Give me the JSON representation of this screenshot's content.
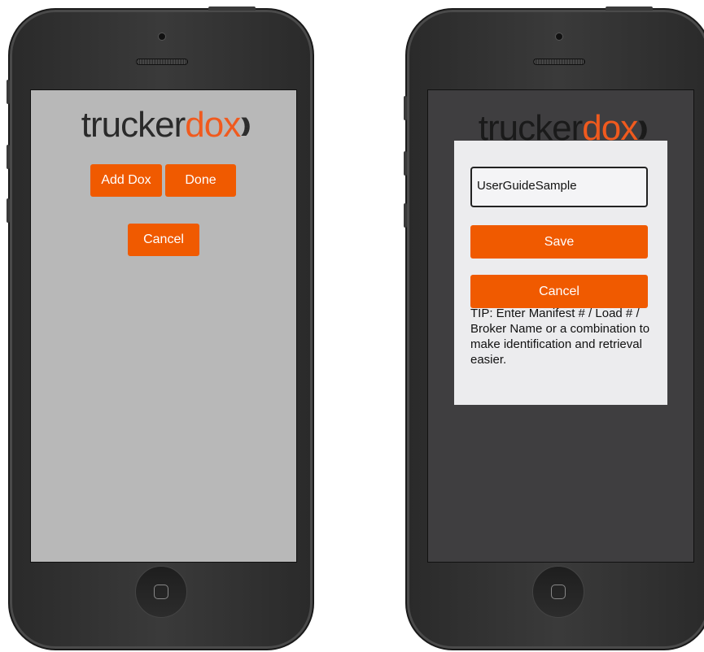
{
  "left_screen": {
    "logo": {
      "text_main": "trucker",
      "text_accent": "dox"
    },
    "buttons": {
      "add_dox": "Add Dox",
      "done": "Done",
      "cancel": "Cancel"
    }
  },
  "right_screen": {
    "logo": {
      "text_main": "trucker",
      "text_accent": "dox"
    },
    "dialog": {
      "input_value": "UserGuideSample",
      "save_label": "Save",
      "cancel_label": "Cancel",
      "tip": "TIP: Enter Manifest # / Load # / Broker Name or a combination to make identification and retrieval easier."
    }
  },
  "colors": {
    "accent": "#f05a00",
    "left_screen_bg": "#b8b8b8",
    "right_screen_bg": "#3f3e40",
    "dialog_bg": "#ececee",
    "phone_body": "#2e2e2e"
  },
  "icons": [
    "home-button-icon",
    "camera-icon",
    "speaker-icon",
    "signal-waves-icon"
  ]
}
